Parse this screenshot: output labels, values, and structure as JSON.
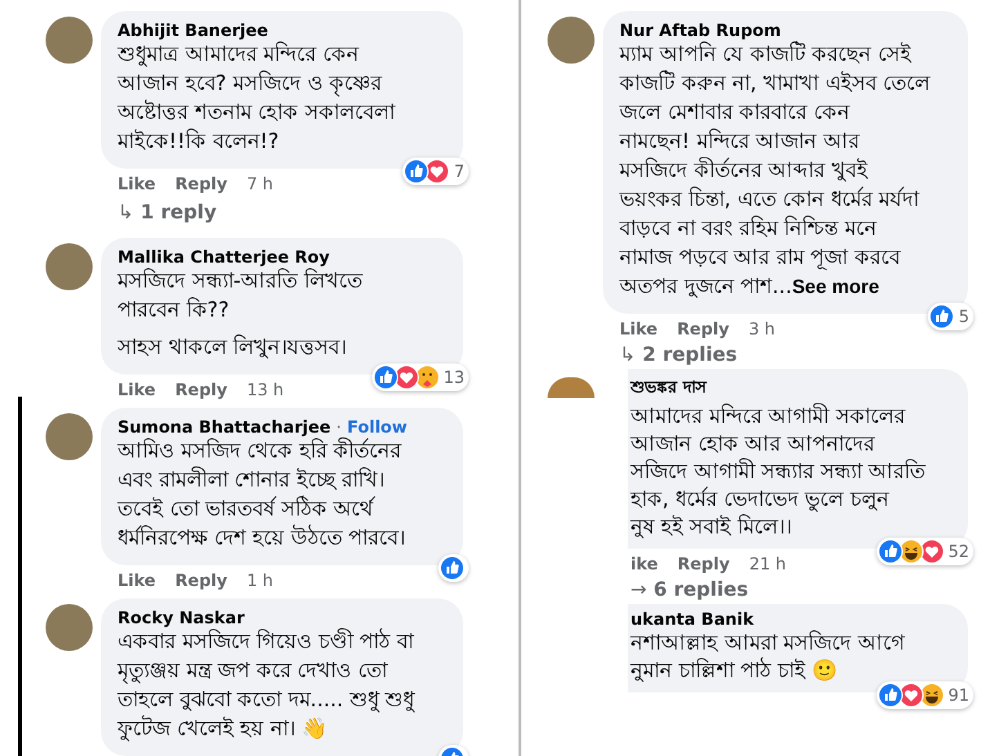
{
  "left_column": [
    {
      "kind": "full",
      "highlighted": false,
      "name": "Abhijit Banerjee",
      "paragraphs": [
        [
          "শুধুমাত্র আমাদের মন্দিরে কেন",
          "আজান হবে? মসজিদে ও কৃষ্ণের",
          "অষ্টোত্তর শতনাম হোক সকালবেলা",
          "মাইকে!!কি বলেন!?"
        ]
      ],
      "reactions": [
        {
          "kind": "like"
        },
        {
          "kind": "love"
        }
      ],
      "reaction_count": "7",
      "actions": [
        "Like",
        "Reply"
      ],
      "time": "7 h",
      "replies": {
        "arrow": "↳",
        "label": "1 reply"
      }
    },
    {
      "kind": "full",
      "highlighted": false,
      "name": "Mallika Chatterjee Roy",
      "paragraphs": [
        [
          "মসজিদে সন্ধ্যা-আরতি লিখতে",
          "পারবেন কি??"
        ],
        [
          "সাহস থাকলে লিখুন।যত্তসব।"
        ]
      ],
      "reactions": [
        {
          "kind": "like"
        },
        {
          "kind": "love"
        },
        {
          "kind": "care"
        }
      ],
      "reaction_count": "13",
      "actions": [
        "Like",
        "Reply"
      ],
      "time": "13 h"
    },
    {
      "kind": "full",
      "highlighted": true,
      "name": "Sumona Bhattacharjee",
      "separator": "·",
      "follow": "Follow",
      "paragraphs": [
        [
          "আমিও মসজিদ থেকে হরি কীর্তনের",
          "এবং রামলীলা শোনার ইচ্ছে রাখি।",
          "তবেই তো ভারতবর্ষ সঠিক অর্থে",
          "ধর্মনিরপেক্ষ দেশ হয়ে উঠতে পারবে।"
        ]
      ],
      "reactions": [
        {
          "kind": "like"
        }
      ],
      "actions": [
        "Like",
        "Reply"
      ],
      "time": "1 h"
    },
    {
      "kind": "full",
      "highlighted": true,
      "name": "Rocky Naskar",
      "paragraphs": [
        [
          "একবার মসজিদে গিয়েও চণ্ডী পাঠ বা",
          "মৃত্যুঞ্জয় মন্ত্র জপ করে দেখাও তো",
          "তাহলে বুঝবো কতো দম..... শুধু শুধু",
          "ফুটেজ খেলেই হয় না। 👋"
        ]
      ],
      "reactions": [
        {
          "kind": "like"
        }
      ]
    }
  ],
  "right_column": [
    {
      "kind": "full",
      "highlighted": false,
      "name": "Nur Aftab Rupom",
      "paragraphs": [
        [
          "ম্যাম আপনি যে কাজটি করছেন সেই",
          "কাজটি করুন না, খামাখা এইসব তেলে",
          "জলে মেশাবার কারবারে কেন",
          "নামছেন! মন্দিরে আজান আর",
          "মসজিদে কীর্তনের আব্দার খুবই",
          "ভয়ংকর চিন্তা, এতে কোন ধর্মের মর্যদা",
          "বাড়বে না বরং রহিম নিশ্চিন্ত মনে",
          "নামাজ পড়বে আর রাম পূজা করবে",
          "অতপর দুজনে পাশ..."
        ]
      ],
      "see_more": "See more",
      "reactions": [
        {
          "kind": "like"
        }
      ],
      "reaction_count": "5",
      "actions": [
        "Like",
        "Reply"
      ],
      "time": "3 h",
      "replies": {
        "arrow": "↳",
        "label": "2 replies"
      }
    },
    {
      "kind": "clipped",
      "highlighted": false,
      "name": "শুভঙ্কর দাস",
      "paragraphs": [
        [
          "আমাদের মন্দিরে আগামী সকালের",
          "আজান হোক আর আপনাদের",
          "সজিদে আগামী সন্ধ্যার সন্ধ্যা আরতি",
          "হাক, ধর্মের ভেদাভেদ ভুলে চলুন",
          "নুষ হই সবাই মিলে।।"
        ]
      ],
      "reactions": [
        {
          "kind": "like"
        },
        {
          "kind": "haha"
        },
        {
          "kind": "love"
        }
      ],
      "reaction_count": "52",
      "actions": [
        "ike",
        "Reply"
      ],
      "time": "21 h",
      "replies": {
        "arrow": "→",
        "label": "6 replies"
      }
    },
    {
      "kind": "clipped",
      "highlighted": false,
      "name": "ukanta Banik",
      "paragraphs": [
        [
          "নশাআল্লাহ আমরা মসজিদে আগে",
          "নুমান চাল্লিশা পাঠ চাই 🙂"
        ]
      ],
      "reactions": [
        {
          "kind": "like"
        },
        {
          "kind": "love"
        },
        {
          "kind": "haha"
        }
      ],
      "reaction_count": "91"
    }
  ]
}
